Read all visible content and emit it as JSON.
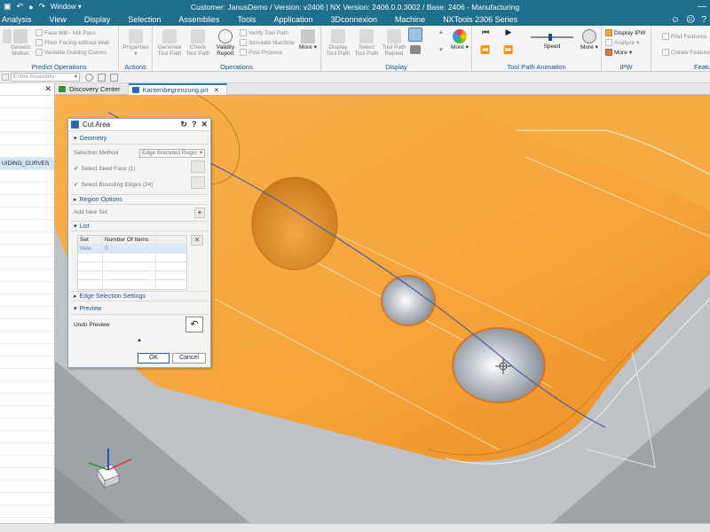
{
  "titlebar": {
    "window_label": "Window",
    "title": "Customer: JanusDemo / Version: v2406 | NX Version: 2406.0.0.3002 / Base: 2406 - Manufacturing"
  },
  "menu": {
    "items": [
      "Analysis",
      "View",
      "Display",
      "Selection",
      "Assemblies",
      "Tools",
      "Application",
      "3Dconnexion",
      "Machine",
      "NXTools 2306 Series"
    ]
  },
  "ribbon": {
    "predict": {
      "label": "Predict Operations",
      "b1": "Generic Motion",
      "s1": "Face Mill - Mill Pass",
      "s2": "Floor Facing without Wall",
      "s3": "Variable Guiding Curves"
    },
    "actions": {
      "label": "Actions",
      "properties": "Properties"
    },
    "operations": {
      "label": "Operations",
      "generate": "Generate Tool Path",
      "check": "Check Tool Path",
      "validity": "Validity Report",
      "s1": "Verify Tool Path",
      "s2": "Simulate Machine",
      "s3": "Post Process",
      "more": "More"
    },
    "display": {
      "label": "Display",
      "display_tp": "Display Tool Path",
      "select_tp": "Select Tool Path",
      "repeat_tp": "Tool Path Repeat",
      "more": "More"
    },
    "animation": {
      "label": "Tool Path Animation",
      "speed": "Speed",
      "more": "More"
    },
    "ipw": {
      "label": "IPW",
      "display": "Display IPW",
      "analyze": "Analyze",
      "more": "More"
    },
    "feature": {
      "label": "Feature",
      "find": "Find Features",
      "create": "Create Feature"
    }
  },
  "toolbar2": {
    "filter": "Entire Assembly"
  },
  "navigator": {
    "selected_row": "UIDING_CURVES"
  },
  "tabs": [
    {
      "label": "Discovery Center"
    },
    {
      "label": "Kantenbegrenzung.prt"
    }
  ],
  "dialog": {
    "title": "Cut Area",
    "geometry": "Geometry",
    "selection_method_label": "Selection Method",
    "selection_method_value": "Edge Bounded Regio",
    "seed_face": "Select Seed Face (1)",
    "bounding_edges": "Select Bounding Edges (24)",
    "region_options": "Region Options",
    "add_new_set": "Add New Set",
    "list": "List",
    "col_set": "Set",
    "col_items": "Number Of Items",
    "row_set": "New",
    "row_items": "0",
    "edge_settings": "Edge Selection Settings",
    "preview": "Preview",
    "undo_preview": "Undo Preview",
    "ok": "OK",
    "cancel": "Cancel"
  },
  "colors": {
    "title_bar": "#1f6e8c",
    "part": "#f5a742",
    "accent": "#1a4f8b"
  }
}
